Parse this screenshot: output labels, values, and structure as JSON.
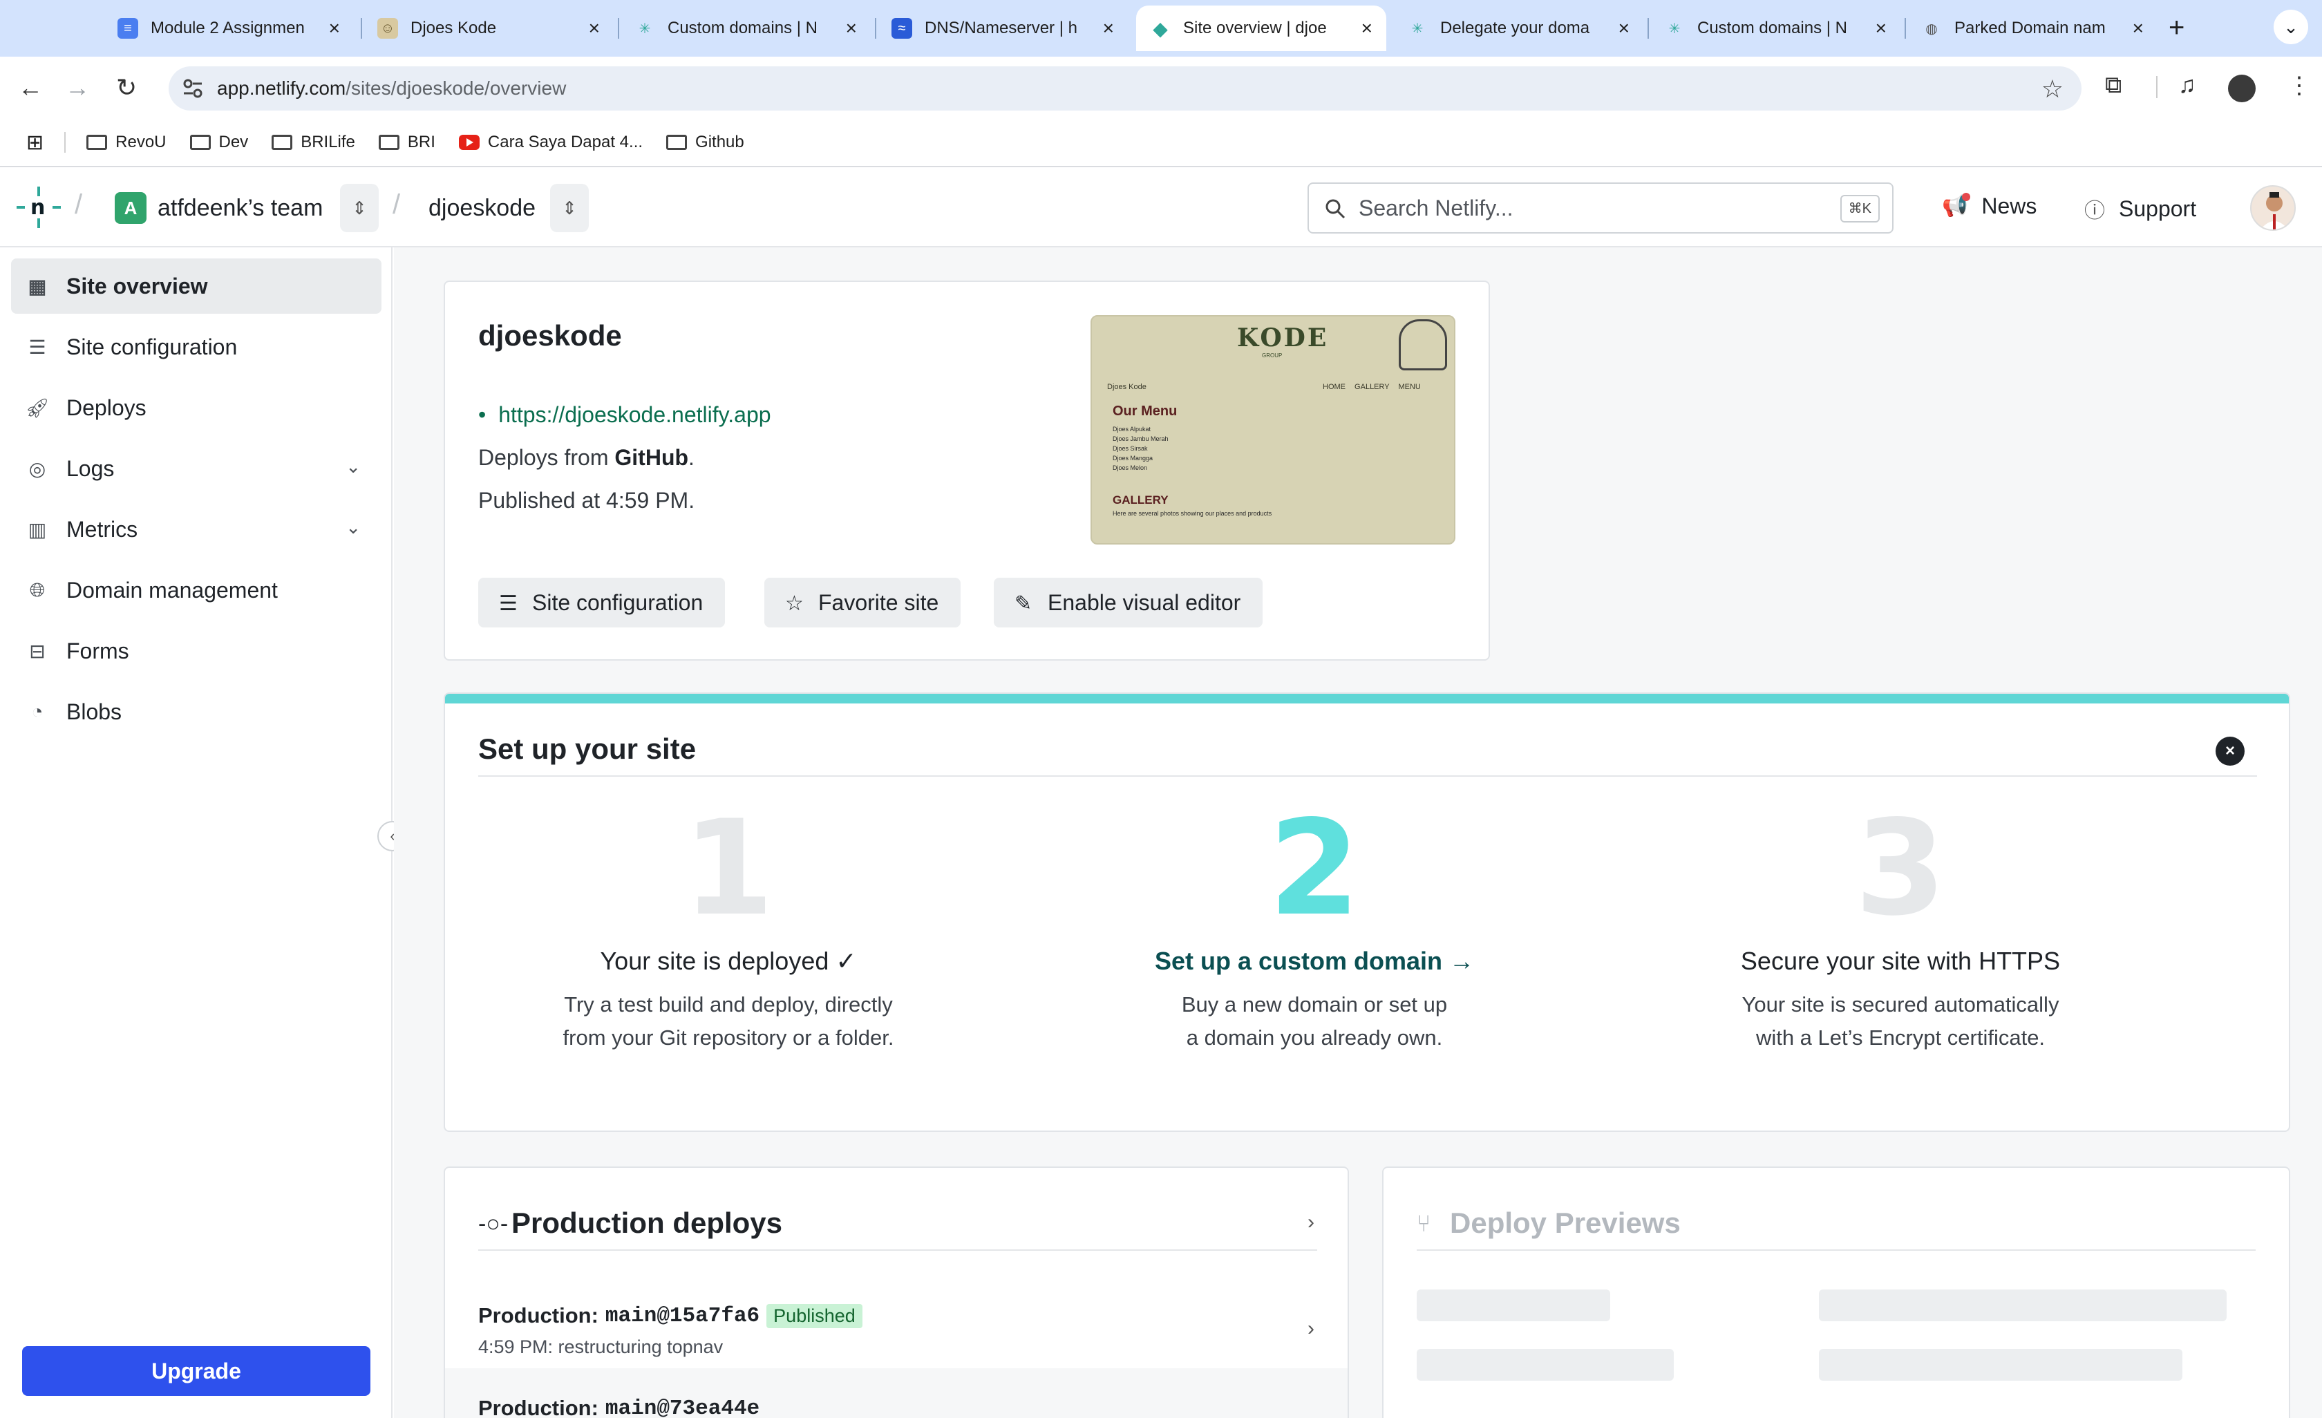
{
  "browser": {
    "tabs": [
      {
        "title": "Module 2 Assignmen",
        "favicon_color": "#4a7ef0",
        "favicon_glyph": "≡"
      },
      {
        "title": "Djoes Kode",
        "favicon_color": "#d8c9a0",
        "favicon_glyph": "☺"
      },
      {
        "title": "Custom domains | N",
        "favicon_color": "#ffffff",
        "favicon_glyph": "✳"
      },
      {
        "title": "DNS/Nameserver | h",
        "favicon_color": "#2a5bd7",
        "favicon_glyph": "≈"
      },
      {
        "title": "Site overview | djoe",
        "favicon_color": "#2fa89a",
        "favicon_glyph": "◆"
      },
      {
        "title": "Delegate your doma",
        "favicon_color": "#ffffff",
        "favicon_glyph": "✳"
      },
      {
        "title": "Custom domains | N",
        "favicon_color": "#ffffff",
        "favicon_glyph": "✳"
      },
      {
        "title": "Parked Domain nam",
        "favicon_color": "#ffffff",
        "favicon_glyph": "◍"
      }
    ],
    "url_host": "app.netlify.com",
    "url_path": "/sites/djoeskode/overview",
    "bookmarks": [
      {
        "label": "RevoU",
        "icon": "folder-icon"
      },
      {
        "label": "Dev",
        "icon": "folder-icon"
      },
      {
        "label": "BRILife",
        "icon": "folder-icon"
      },
      {
        "label": "BRI",
        "icon": "folder-icon"
      },
      {
        "label": "Cara Saya Dapat 4...",
        "icon": "youtube-icon"
      },
      {
        "label": "Github",
        "icon": "folder-icon"
      }
    ]
  },
  "header": {
    "team_initial": "A",
    "team_name": "atfdeenk’s team",
    "site_name": "djoeskode",
    "search_placeholder": "Search Netlify...",
    "search_shortcut": "⌘K",
    "news_label": "News",
    "support_label": "Support"
  },
  "sidebar": {
    "items": [
      {
        "label": "Site overview",
        "icon": "grid-icon",
        "active": true
      },
      {
        "label": "Site configuration",
        "icon": "config-icon"
      },
      {
        "label": "Deploys",
        "icon": "rocket-icon"
      },
      {
        "label": "Logs",
        "icon": "logs-icon",
        "expandable": true
      },
      {
        "label": "Metrics",
        "icon": "metrics-icon",
        "expandable": true
      },
      {
        "label": "Domain management",
        "icon": "globe-icon"
      },
      {
        "label": "Forms",
        "icon": "forms-icon"
      },
      {
        "label": "Blobs",
        "icon": "blobs-icon"
      }
    ],
    "upgrade_label": "Upgrade"
  },
  "site_card": {
    "name": "djoeskode",
    "url": "https://djoeskode.netlify.app",
    "deploys_prefix": "Deploys from ",
    "deploys_source": "GitHub",
    "deploys_suffix": ".",
    "published": "Published at 4:59 PM.",
    "preview": {
      "logo": "KODE",
      "logo_sub": "GROUP",
      "brand": "Djoes Kode",
      "nav": "HOME GALLERY MENU",
      "menu_title": "Our Menu",
      "menu_items": [
        "Djoes Alpukat",
        "Djoes Jambu Merah",
        "Djoes Sirsak",
        "Djoes Mangga",
        "Djoes Melon"
      ],
      "gallery_title": "GALLERY",
      "gallery_sub": "Here are several photos showing our places and products"
    },
    "buttons": {
      "site_config": "Site configuration",
      "favorite": "Favorite site",
      "visual_editor": "Enable visual editor"
    }
  },
  "setup": {
    "title": "Set up your site",
    "steps": [
      {
        "number": "1",
        "title": "Your site is deployed ✓",
        "desc_line1": "Try a test build and deploy, directly",
        "desc_line2": "from your Git repository or a folder."
      },
      {
        "number": "2",
        "title": "Set up a custom domain →",
        "desc_line1": "Buy a new domain or set up",
        "desc_line2": "a domain you already own."
      },
      {
        "number": "3",
        "title": "Secure your site with HTTPS",
        "desc_line1": "Your site is secured automatically",
        "desc_line2": "with a Let’s Encrypt certificate."
      }
    ]
  },
  "production": {
    "title": "Production deploys",
    "deploys": [
      {
        "label": "Production:",
        "ref": "main@15a7fa6",
        "status": "Published",
        "detail": "4:59 PM: restructuring topnav"
      },
      {
        "label": "Production:",
        "ref": "main@73ea44e",
        "status": "",
        "detail": ""
      }
    ]
  },
  "previews": {
    "title": "Deploy Previews"
  }
}
